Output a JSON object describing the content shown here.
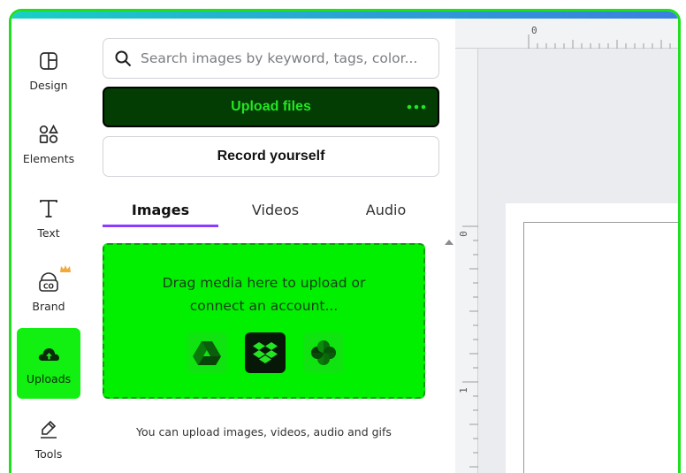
{
  "rail": {
    "items": [
      {
        "label": "Design",
        "icon": "layout-icon",
        "active": false
      },
      {
        "label": "Elements",
        "icon": "shapes-icon",
        "active": false
      },
      {
        "label": "Text",
        "icon": "text-icon",
        "active": false
      },
      {
        "label": "Brand",
        "icon": "brand-kit-icon",
        "active": false
      },
      {
        "label": "Uploads",
        "icon": "cloud-upload-icon",
        "active": true
      },
      {
        "label": "Tools",
        "icon": "pen-tool-icon",
        "active": false
      }
    ]
  },
  "panel": {
    "search_placeholder": "Search images by keyword, tags, color...",
    "upload_label": "Upload files",
    "record_label": "Record yourself",
    "tabs": [
      {
        "label": "Images",
        "active": true
      },
      {
        "label": "Videos",
        "active": false
      },
      {
        "label": "Audio",
        "active": false
      }
    ],
    "dropzone": {
      "line1": "Drag media here to upload or",
      "line2": "connect an account...",
      "sources": [
        "google-drive-icon",
        "dropbox-icon",
        "google-photos-icon"
      ]
    },
    "hint": "You can upload images, videos, audio and gifs"
  },
  "rulers": {
    "top_zero": "0",
    "left_zero": "0",
    "left_one": "1"
  },
  "colors": {
    "accent_green": "#00f000",
    "upload_button_bg": "#033d03",
    "upload_button_text": "#22e622",
    "tab_indicator": "#8b3dff",
    "frame_border": "#1fe01f",
    "crown": "#f2a93b"
  }
}
